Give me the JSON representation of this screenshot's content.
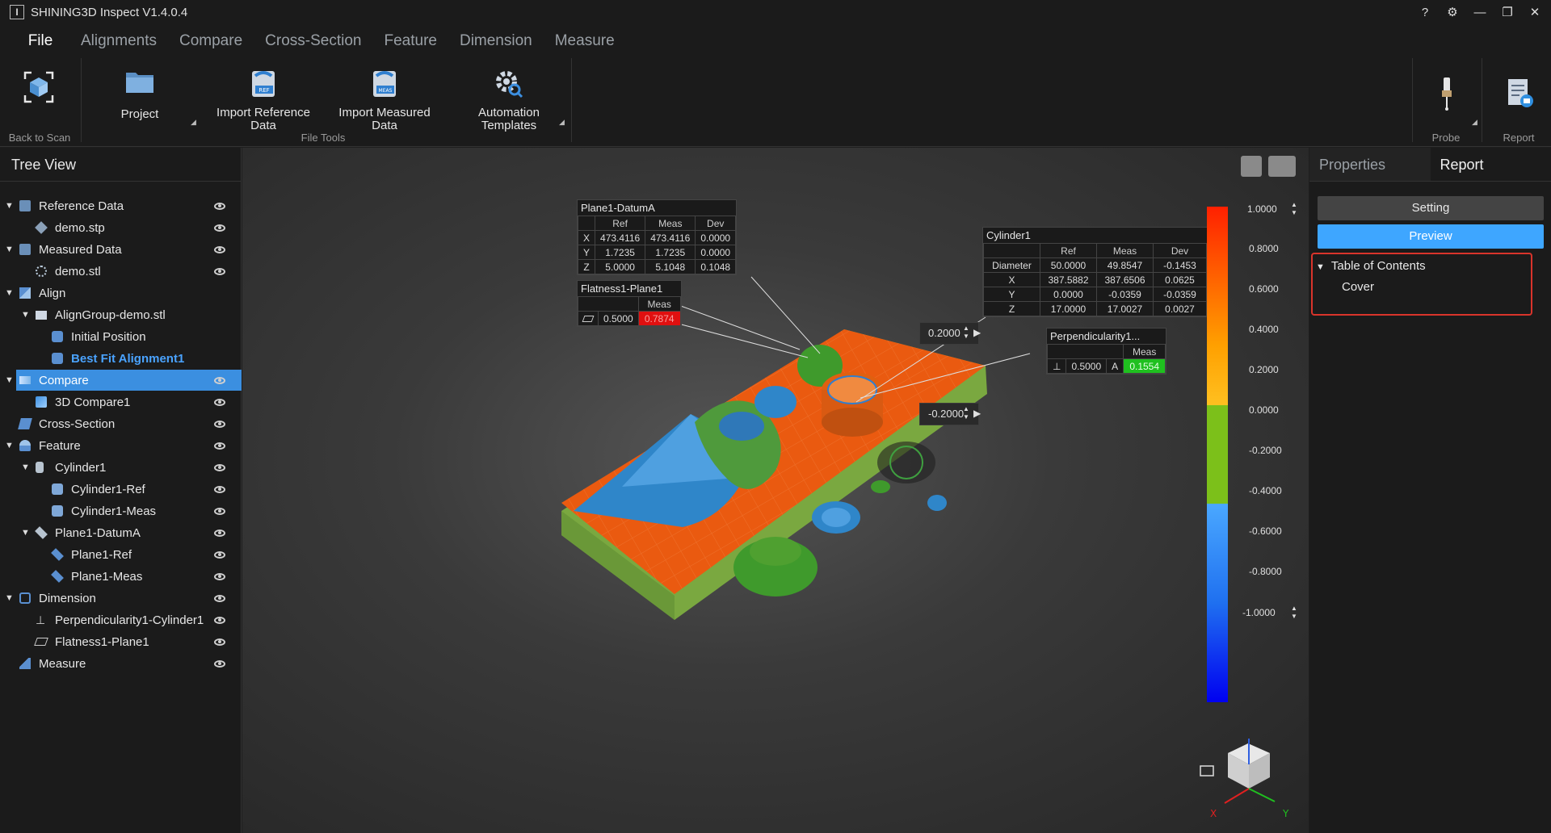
{
  "window": {
    "title": "SHINING3D Inspect V1.4.0.4",
    "controls": [
      "?",
      "⚙",
      "—",
      "❐",
      "✕"
    ]
  },
  "menu": {
    "file": "File",
    "items": [
      "Alignments",
      "Compare",
      "Cross-Section",
      "Feature",
      "Dimension",
      "Measure"
    ]
  },
  "ribbon": {
    "back_to_scan": "Back to Scan",
    "project": "Project",
    "import_ref_1": "Import Reference",
    "import_ref_2": "Data",
    "import_meas_1": "Import Measured",
    "import_meas_2": "Data",
    "automation_1": "Automation",
    "automation_2": "Templates",
    "file_tools": "File Tools",
    "probe": "Probe",
    "report": "Report",
    "ref_badge": "REF",
    "meas_badge": "MEAS"
  },
  "tree": {
    "header": "Tree View",
    "items": [
      {
        "label": "Reference Data"
      },
      {
        "label": "demo.stp"
      },
      {
        "label": "Measured Data"
      },
      {
        "label": "demo.stl"
      },
      {
        "label": "Align"
      },
      {
        "label": "AlignGroup-demo.stl"
      },
      {
        "label": "Initial Position"
      },
      {
        "label": "Best Fit Alignment1"
      },
      {
        "label": "Compare"
      },
      {
        "label": "3D Compare1"
      },
      {
        "label": "Cross-Section"
      },
      {
        "label": "Feature"
      },
      {
        "label": "Cylinder1"
      },
      {
        "label": "Cylinder1-Ref"
      },
      {
        "label": "Cylinder1-Meas"
      },
      {
        "label": "Plane1-DatumA"
      },
      {
        "label": "Plane1-Ref"
      },
      {
        "label": "Plane1-Meas"
      },
      {
        "label": "Dimension"
      },
      {
        "label": "Perpendicularity1-Cylinder1"
      },
      {
        "label": "Flatness1-Plane1"
      },
      {
        "label": "Measure"
      }
    ]
  },
  "annotations": {
    "plane": {
      "title": "Plane1-DatumA",
      "headers": [
        "Ref",
        "Meas",
        "Dev"
      ],
      "rows": [
        [
          "X",
          "473.4116",
          "473.4116",
          "0.0000"
        ],
        [
          "Y",
          "1.7235",
          "1.7235",
          "0.0000"
        ],
        [
          "Z",
          "5.0000",
          "5.1048",
          "0.1048"
        ]
      ]
    },
    "flatness": {
      "title": "Flatness1-Plane1",
      "header": "Meas",
      "tol": "0.5000",
      "meas": "0.7874"
    },
    "cylinder": {
      "title": "Cylinder1",
      "headers": [
        "Ref",
        "Meas",
        "Dev"
      ],
      "rows": [
        [
          "Diameter",
          "50.0000",
          "49.8547",
          "-0.1453"
        ],
        [
          "X",
          "387.5882",
          "387.6506",
          "0.0625"
        ],
        [
          "Y",
          "0.0000",
          "-0.0359",
          "-0.0359"
        ],
        [
          "Z",
          "17.0000",
          "17.0027",
          "0.0027"
        ]
      ]
    },
    "perp": {
      "title": "Perpendicularity1...",
      "header": "Meas",
      "tol": "0.5000",
      "datum": "A",
      "meas": "0.1554"
    }
  },
  "scale": {
    "max": "1.0000",
    "min": "-1.0000",
    "upper_tol": "0.2000",
    "lower_tol": "-0.2000",
    "ticks": [
      "0.8000",
      "0.6000",
      "0.4000",
      "0.2000",
      "0.0000",
      "-0.2000",
      "-0.4000",
      "-0.6000",
      "-0.8000"
    ]
  },
  "axes": {
    "x": "X",
    "y": "Y"
  },
  "right_panel": {
    "tabs": [
      "Properties",
      "Report"
    ],
    "setting": "Setting",
    "preview": "Preview",
    "toc": "Table of Contents",
    "cover": "Cover"
  },
  "colors": {
    "accent": "#3b8fe0",
    "preview_button": "#3ea6ff",
    "fail": "#e01010",
    "pass": "#1fc01f",
    "highlight_border": "#d9342b"
  }
}
